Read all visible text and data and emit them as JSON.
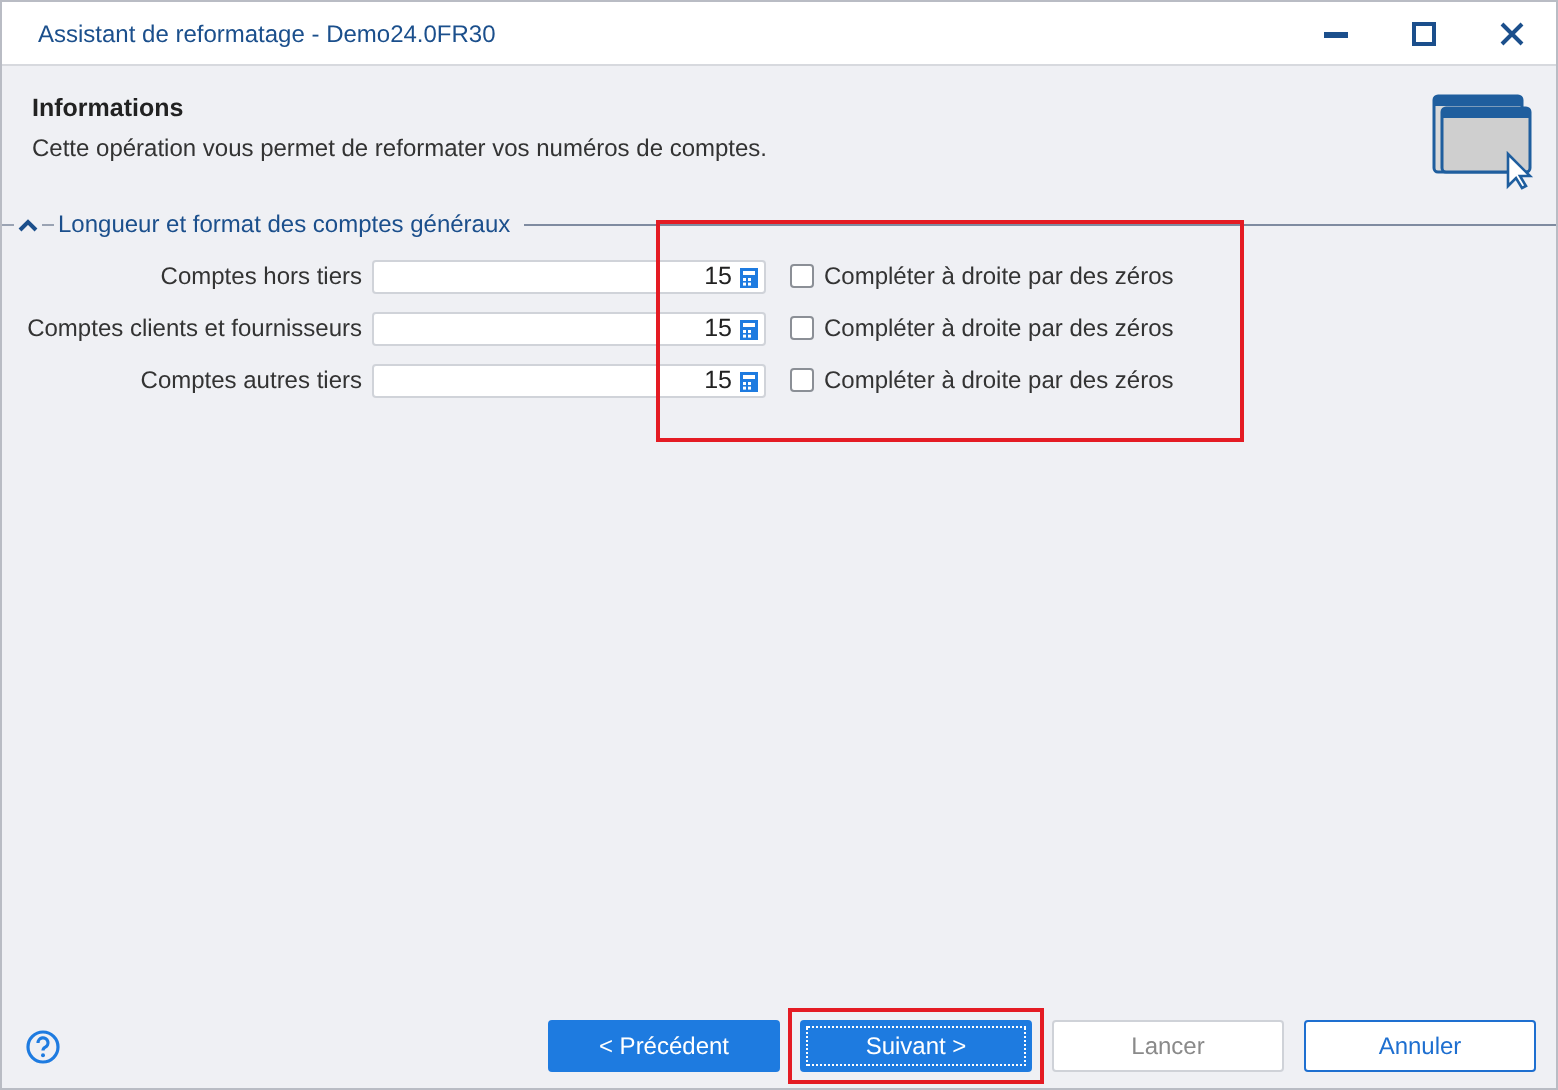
{
  "window": {
    "title": "Assistant de reformatage - Demo24.0FR30"
  },
  "header": {
    "title": "Informations",
    "description": "Cette opération vous permet de reformater vos numéros de comptes."
  },
  "section": {
    "title": "Longueur et format des comptes généraux",
    "expanded": true,
    "highlighted": true,
    "rows": [
      {
        "label": "Comptes hors tiers",
        "value": "15",
        "option": "Compléter à droite par des zéros",
        "checked": false
      },
      {
        "label": "Comptes clients et fournisseurs",
        "value": "15",
        "option": "Compléter à droite par des zéros",
        "checked": false
      },
      {
        "label": "Comptes autres tiers",
        "value": "15",
        "option": "Compléter à droite par des zéros",
        "checked": false
      }
    ]
  },
  "buttons": [
    {
      "label": "< Précédent",
      "kind": "primary",
      "disabled": false,
      "focused": false,
      "highlighted": false
    },
    {
      "label": "Suivant >",
      "kind": "primary",
      "disabled": false,
      "focused": true,
      "highlighted": true
    },
    {
      "label": "Lancer",
      "kind": "default",
      "disabled": true,
      "focused": false,
      "highlighted": false
    },
    {
      "label": "Annuler",
      "kind": "outline",
      "disabled": false,
      "focused": false,
      "highlighted": false
    }
  ]
}
